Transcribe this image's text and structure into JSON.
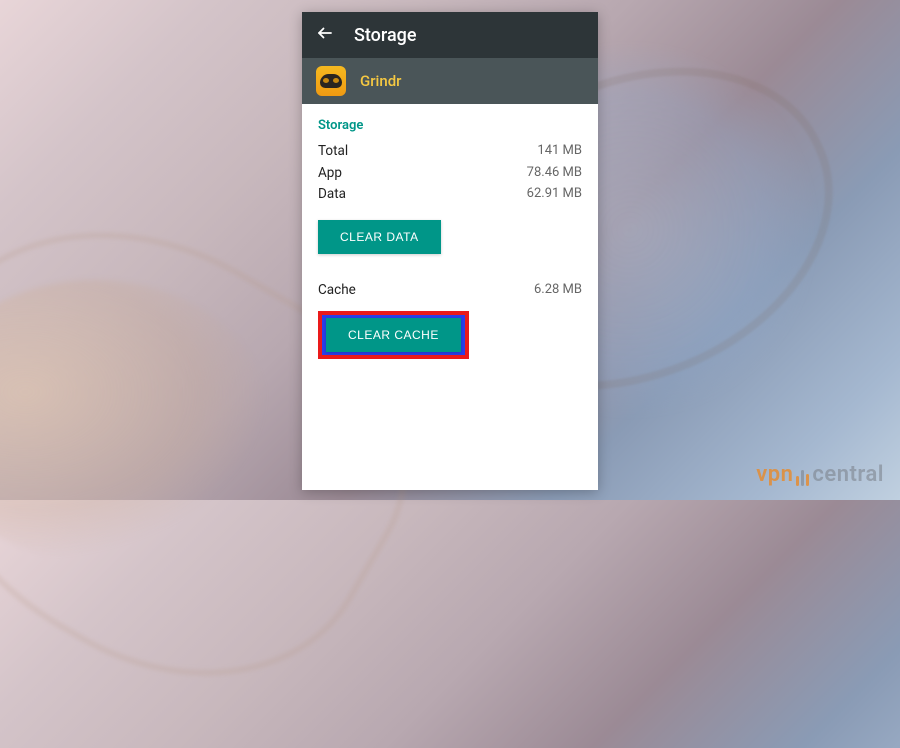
{
  "titlebar": {
    "title": "Storage"
  },
  "app": {
    "name": "Grindr"
  },
  "storage": {
    "section_label": "Storage",
    "rows": [
      {
        "label": "Total",
        "value": "141 MB"
      },
      {
        "label": "App",
        "value": "78.46 MB"
      },
      {
        "label": "Data",
        "value": "62.91 MB"
      }
    ],
    "clear_data_label": "CLEAR DATA"
  },
  "cache": {
    "label": "Cache",
    "value": "6.28 MB",
    "clear_cache_label": "CLEAR CACHE"
  },
  "watermark": {
    "part1": "vpn",
    "part2": "central"
  }
}
